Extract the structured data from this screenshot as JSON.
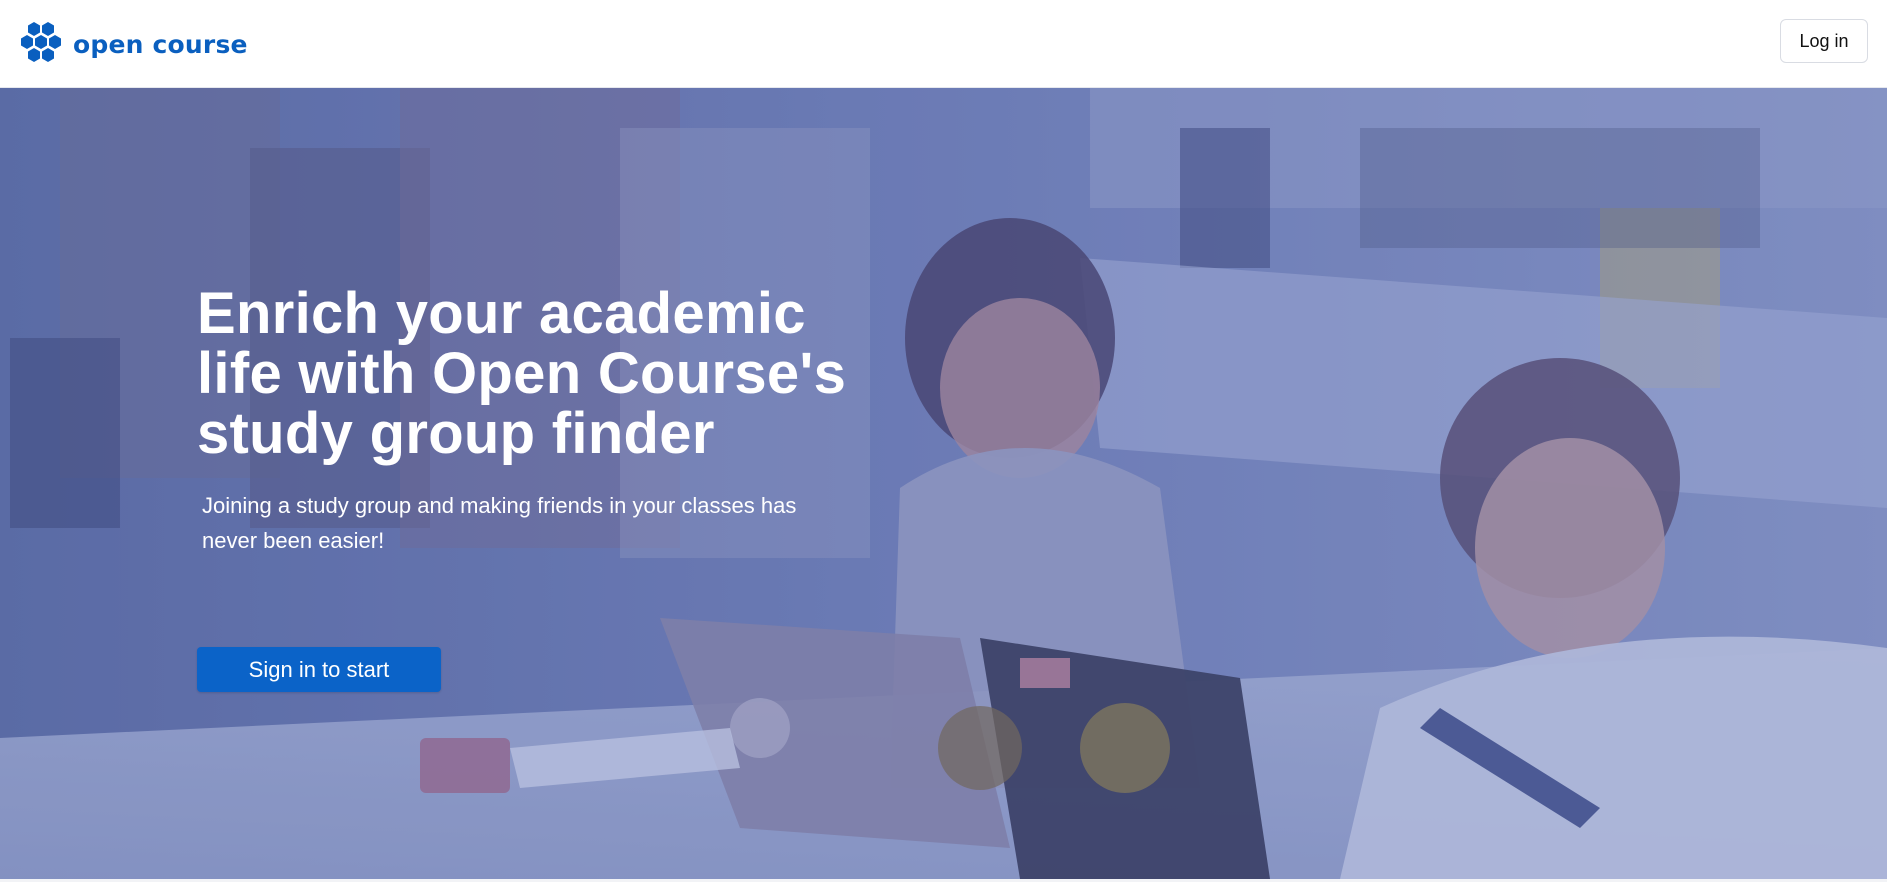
{
  "header": {
    "brand_name": "open course",
    "brand_icon": "hexagon-cluster-icon",
    "login_label": "Log in",
    "brand_color": "#0a5fbf"
  },
  "hero": {
    "title": "Enrich your academic life with Open Course's study group finder",
    "subtitle": "Joining a study group and making friends in your classes has never been easier!",
    "cta_label": "Sign in to start",
    "cta_color": "#0b63c8",
    "overlay_color": "#6f7eb4"
  }
}
